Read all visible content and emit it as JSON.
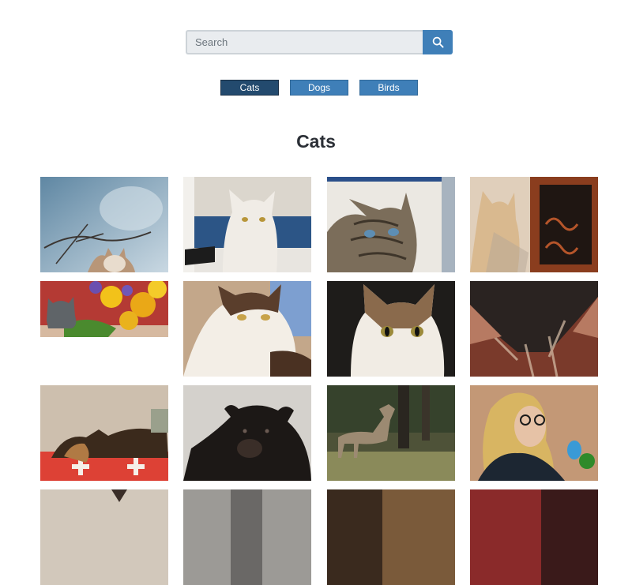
{
  "search": {
    "placeholder": "Search",
    "button_icon": "search-icon"
  },
  "tabs": [
    {
      "label": "Cats",
      "active": true
    },
    {
      "label": "Dogs",
      "active": false
    },
    {
      "label": "Birds",
      "active": false
    }
  ],
  "gallery": {
    "title": "Cats",
    "photos": [
      {
        "subject": "cat-by-branches",
        "colors": [
          "#7fa0b6",
          "#c8d6e0"
        ]
      },
      {
        "subject": "white-cat",
        "colors": [
          "#e9e4da",
          "#2d5a8a"
        ]
      },
      {
        "subject": "tabby-cat-closeup",
        "colors": [
          "#8a7a62",
          "#e6e2d8"
        ]
      },
      {
        "subject": "cat-on-balcony",
        "colors": [
          "#d9c7b2",
          "#8a3d1e"
        ]
      },
      {
        "subject": "cat-with-sunflowers",
        "colors": [
          "#e7b11c",
          "#6a5aa8"
        ]
      },
      {
        "subject": "calico-cat-lying",
        "colors": [
          "#b8a38c",
          "#6e8cc4"
        ]
      },
      {
        "subject": "calico-cat-dark",
        "colors": [
          "#2a2622",
          "#a98c6d"
        ]
      },
      {
        "subject": "cat-ears-closeup",
        "colors": [
          "#7a3a2e",
          "#2b2422"
        ]
      },
      {
        "subject": "dog-on-cushion",
        "colors": [
          "#c9b7a4",
          "#d8473a"
        ]
      },
      {
        "subject": "black-bear",
        "colors": [
          "#d6d3ce",
          "#1e1a18"
        ]
      },
      {
        "subject": "deer-in-woods",
        "colors": [
          "#5b5a3d",
          "#a89a84"
        ]
      },
      {
        "subject": "woman-with-budgie",
        "colors": [
          "#c49a7a",
          "#1f2a34"
        ]
      },
      {
        "subject": "partial-photo",
        "colors": [
          "#d2c8bb",
          "#8a7a6a"
        ]
      },
      {
        "subject": "partial-photo",
        "colors": [
          "#9c9a96",
          "#5a5856"
        ]
      },
      {
        "subject": "partial-photo",
        "colors": [
          "#7a5a3a",
          "#3a2a1e"
        ]
      },
      {
        "subject": "partial-photo",
        "colors": [
          "#8a2a2a",
          "#3a1a1a"
        ]
      }
    ]
  }
}
